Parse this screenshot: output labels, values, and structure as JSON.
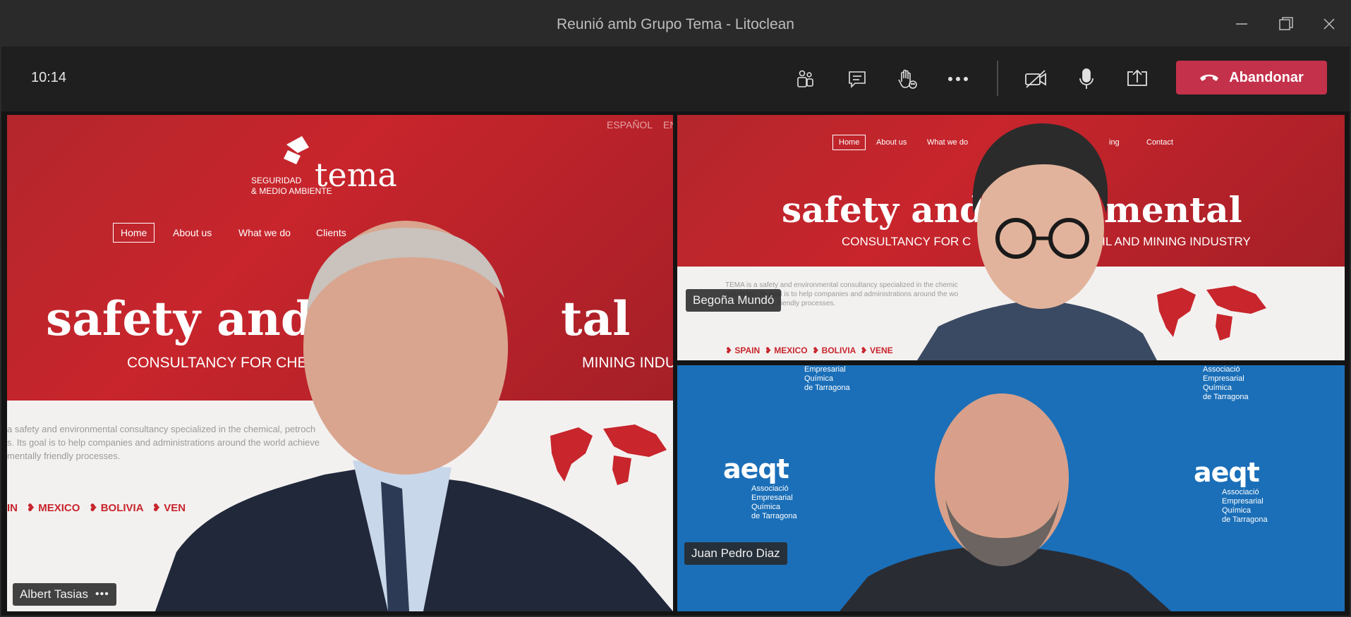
{
  "window": {
    "title": "Reunió amb Grupo Tema - Litoclean"
  },
  "toolbar": {
    "time": "10:14",
    "leave_label": "Abandonar",
    "leave_color": "#c4314b"
  },
  "participants": [
    {
      "name": "Albert Tasias",
      "more": "•••"
    },
    {
      "name": "Begoña Mundó"
    },
    {
      "name": "Juan Pedro Diaz"
    }
  ],
  "shared_site": {
    "brand_top": "SEGURIDAD",
    "brand_name": "tema",
    "brand_sub": "& MEDIO AMBIENTE",
    "lang_es": "ESPAÑOL",
    "lang_en": "EN",
    "nav": [
      "Home",
      "About us",
      "What we do",
      "Clients",
      "Contact"
    ],
    "nav_partial_extra": "ing",
    "headline_left": "safety and en",
    "headline_right": "tal",
    "headline2_left": "safety and",
    "headline2_right": "mental",
    "sub_left": "CONSULTANCY FOR CHEMICA",
    "sub_right": "MINING INDU",
    "sub2_left": "CONSULTANCY FOR C",
    "sub2_right": "L, OIL AND MINING INDUSTRY",
    "body1": "a safety and environmental consultancy specialized in the chemical, petroch",
    "body2": "s. Its goal is to help companies and administrations around the world achieve",
    "body3": "mentally friendly processes.",
    "body2_1": "TEMA is a safety and environmental consultancy specialized in the chemic",
    "body2_2": "industries. Its goal is to help companies and administrations around the wo",
    "body2_3": "environmentally friendly processes.",
    "countries": [
      "IN",
      "MEXICO",
      "BOLIVIA",
      "VEN"
    ],
    "countries2": [
      "SPAIN",
      "MEXICO",
      "BOLIVIA",
      "VENE"
    ]
  },
  "aeqt": {
    "mark": "aeqt",
    "line1": "Associació",
    "line2": "Empresarial",
    "line3": "Química",
    "line4": "de Tarragona"
  },
  "icons": [
    "participants-icon",
    "chat-icon",
    "raise-hand-icon",
    "more-icon",
    "camera-off-icon",
    "microphone-icon",
    "share-screen-icon",
    "phone-hangup-icon"
  ]
}
